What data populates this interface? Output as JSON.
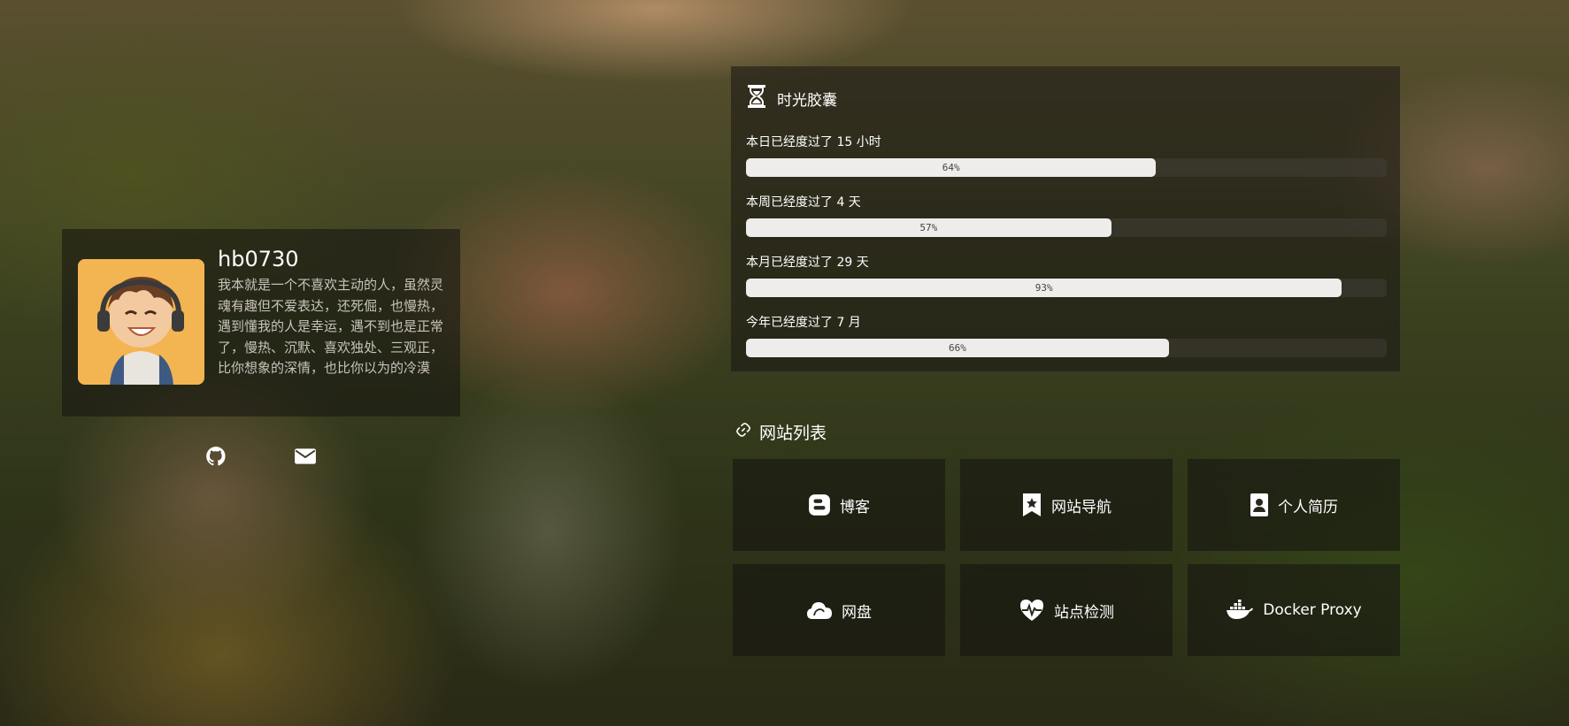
{
  "profile": {
    "username": "hb0730",
    "bio": "我本就是一个不喜欢主动的人，虽然灵魂有趣但不爱表达，还死倔，也慢热，遇到懂我的人是幸运，遇不到也是正常了，慢热、沉默、喜欢独处、三观正，比你想象的深情，也比你以为的冷漠",
    "social_icons": [
      "github-icon",
      "mail-icon"
    ]
  },
  "time_capsule": {
    "title": "时光胶囊",
    "icon": "hourglass-icon",
    "rows": [
      {
        "label": "本日已经度过了 15 小时",
        "percent_text": "64%",
        "percent": 64
      },
      {
        "label": "本周已经度过了 4 天",
        "percent_text": "57%",
        "percent": 57
      },
      {
        "label": "本月已经度过了 29 天",
        "percent_text": "93%",
        "percent": 93
      },
      {
        "label": "今年已经度过了 7 月",
        "percent_text": "66%",
        "percent": 66
      }
    ]
  },
  "sites": {
    "title": "网站列表",
    "icon": "link-icon",
    "items": [
      {
        "label": "博客",
        "icon": "blogger-icon"
      },
      {
        "label": "网站导航",
        "icon": "bookmark-star-icon"
      },
      {
        "label": "个人简历",
        "icon": "resume-icon"
      },
      {
        "label": "网盘",
        "icon": "cloud-icon"
      },
      {
        "label": "站点检测",
        "icon": "heart-pulse-icon"
      },
      {
        "label": "Docker Proxy",
        "icon": "docker-icon"
      }
    ]
  },
  "colors": {
    "bar_fill": "#efedeb",
    "panel_bg": "rgba(25,22,20,0.55)",
    "bio_text": "#c8c3bc"
  }
}
